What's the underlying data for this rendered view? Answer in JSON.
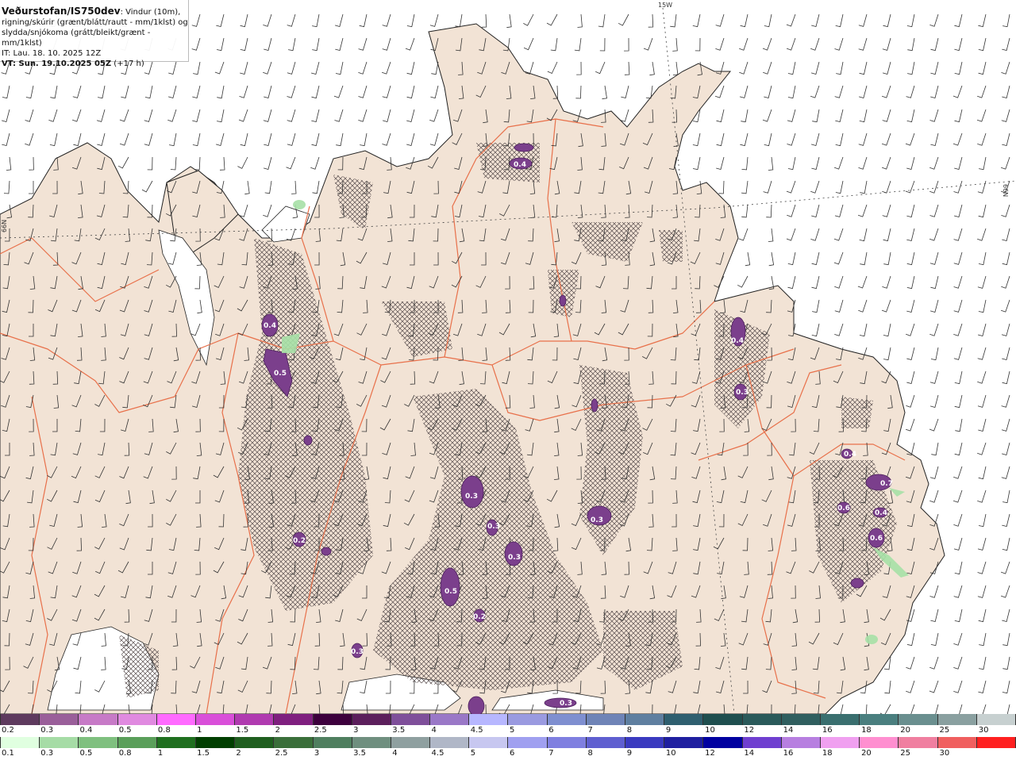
{
  "header": {
    "title_main": "Veðurstofan/IS750dev",
    "title_rest": ": Vindur (10m),",
    "line2": "rigning/skúrir (grænt/blátt/rautt - mm/1klst) og",
    "line3": "slydda/snjókoma (grátt/bleikt/grænt - mm/1klst)",
    "it_line": "IT: Lau. 18. 10. 2025 12Z",
    "vt_line_bold": "VT: Sun. 19.10.2025 05Z",
    "vt_line_rest": " (+17 h)"
  },
  "map_labels": {
    "lon_15w": "15W",
    "lat_66n_left": "66N",
    "lat_66n_right": "66N"
  },
  "colors": {
    "land": "#f2e3d5",
    "sea": "#ffffff",
    "coast": "#222222",
    "roads": "#e8704a",
    "hatch": "#5a4f4f",
    "precip_purple": "#7b3f8c",
    "precip_green": "#a6e0a6"
  },
  "precip_labels": [
    {
      "text": "0.4"
    },
    {
      "text": "0.4"
    },
    {
      "text": "0.5"
    },
    {
      "text": "0.4"
    },
    {
      "text": "0.3"
    },
    {
      "text": "0.3"
    },
    {
      "text": "0.3"
    },
    {
      "text": "0.3"
    },
    {
      "text": "0.3"
    },
    {
      "text": "0.2"
    },
    {
      "text": "0.5"
    },
    {
      "text": "0.2"
    },
    {
      "text": "0.7"
    },
    {
      "text": "0.6"
    },
    {
      "text": "0.4"
    },
    {
      "text": "0.6"
    },
    {
      "text": "0.4"
    },
    {
      "text": "0.3"
    },
    {
      "text": "0.3"
    }
  ],
  "legend_snow": {
    "colors": [
      "#5e3a5e",
      "#9a5f9a",
      "#c77ac7",
      "#e08ae0",
      "#ff6aff",
      "#d94fd9",
      "#b03ab0",
      "#7f1f7f",
      "#3d003d",
      "#5c1f5c",
      "#7f4f9a",
      "#9a78c7",
      "#b7b7ff",
      "#9a9ae0",
      "#7f8fd0",
      "#6f84b7",
      "#5f7fa0",
      "#2f5f6f",
      "#1f4f4f",
      "#2a5a5a",
      "#305f5f",
      "#3a6f6f",
      "#4a7f7f",
      "#6a8f8f",
      "#8aa0a0",
      "#c7d0d0"
    ],
    "labels": [
      "0.2",
      "0.3",
      "0.4",
      "0.5",
      "0.8",
      "1",
      "1.5",
      "2",
      "2.5",
      "3",
      "3.5",
      "4",
      "4.5",
      "5",
      "6",
      "7",
      "8",
      "9",
      "10",
      "12",
      "14",
      "16",
      "18",
      "20",
      "25",
      "30"
    ]
  },
  "legend_rain": {
    "colors": [
      "#e0ffe0",
      "#a6dca6",
      "#7fc07f",
      "#5a9f5a",
      "#1f6f1f",
      "#003f00",
      "#1f5f1f",
      "#3a6f3a",
      "#4f7f5f",
      "#6f8f7f",
      "#8fa0a0",
      "#b0b7c7",
      "#c7c7f0",
      "#a0a0f0",
      "#7f7fe0",
      "#5f5fd0",
      "#3a3ac0",
      "#1f1fa0",
      "#0000a0",
      "#6f3fd0",
      "#b77fe0",
      "#f0a0f0",
      "#ff8fd0",
      "#f07fa0",
      "#f05f5f",
      "#ff2020"
    ],
    "labels": [
      "0.1",
      "0.3",
      "0.5",
      "0.8",
      "1",
      "1.5",
      "2",
      "2.5",
      "3",
      "3.5",
      "4",
      "4.5",
      "5",
      "6",
      "7",
      "8",
      "9",
      "10",
      "12",
      "14",
      "16",
      "18",
      "20",
      "25",
      "30"
    ]
  }
}
